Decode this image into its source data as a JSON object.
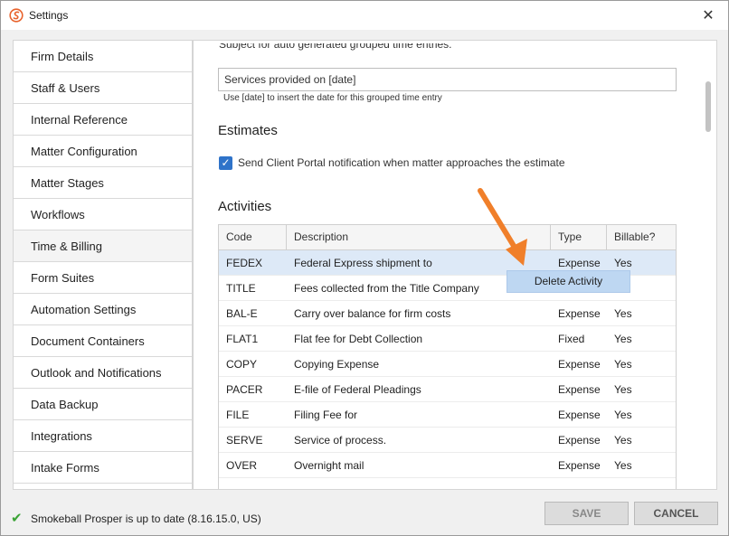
{
  "window": {
    "title": "Settings",
    "close_glyph": "✕",
    "logo_icon": "smokeball-logo"
  },
  "sidebar": {
    "items": [
      {
        "label": "Firm Details",
        "active": false
      },
      {
        "label": "Staff & Users",
        "active": false
      },
      {
        "label": "Internal Reference",
        "active": false
      },
      {
        "label": "Matter Configuration",
        "active": false
      },
      {
        "label": "Matter Stages",
        "active": false
      },
      {
        "label": "Workflows",
        "active": false
      },
      {
        "label": "Time & Billing",
        "active": true
      },
      {
        "label": "Form Suites",
        "active": false
      },
      {
        "label": "Automation Settings",
        "active": false
      },
      {
        "label": "Document Containers",
        "active": false
      },
      {
        "label": "Outlook and Notifications",
        "active": false
      },
      {
        "label": "Data Backup",
        "active": false
      },
      {
        "label": "Integrations",
        "active": false
      },
      {
        "label": "Intake Forms",
        "active": false
      }
    ]
  },
  "main": {
    "cut_label": "Subject for auto generated grouped time entries:",
    "date_input_value": "Services provided on [date]",
    "date_hint": "Use [date] to insert the date for this grouped time entry",
    "estimates_heading": "Estimates",
    "estimate_checkbox_label": "Send Client Portal notification when matter approaches the estimate",
    "estimate_checkbox_checked": true,
    "activities_heading": "Activities",
    "table": {
      "headers": {
        "code": "Code",
        "description": "Description",
        "type": "Type",
        "billable": "Billable?"
      },
      "rows": [
        {
          "code": "FEDEX",
          "description": "Federal Express shipment to",
          "type": "Expense",
          "billable": "Yes",
          "selected": true
        },
        {
          "code": "TITLE",
          "description": "Fees collected from the Title Company",
          "type": "",
          "billable": "",
          "selected": false
        },
        {
          "code": "BAL-E",
          "description": "Carry over balance for firm costs",
          "type": "Expense",
          "billable": "Yes",
          "selected": false
        },
        {
          "code": "FLAT1",
          "description": "Flat fee for Debt Collection",
          "type": "Fixed",
          "billable": "Yes",
          "selected": false
        },
        {
          "code": "COPY",
          "description": "Copying Expense",
          "type": "Expense",
          "billable": "Yes",
          "selected": false
        },
        {
          "code": "PACER",
          "description": "E-file of Federal Pleadings",
          "type": "Expense",
          "billable": "Yes",
          "selected": false
        },
        {
          "code": "FILE",
          "description": "Filing Fee for",
          "type": "Expense",
          "billable": "Yes",
          "selected": false
        },
        {
          "code": "SERVE",
          "description": "Service of process.",
          "type": "Expense",
          "billable": "Yes",
          "selected": false
        },
        {
          "code": "OVER",
          "description": "Overnight mail",
          "type": "Expense",
          "billable": "Yes",
          "selected": false
        }
      ]
    },
    "context_menu": {
      "item": "Delete Activity"
    }
  },
  "footer": {
    "status": "Smokeball Prosper is up to date (8.16.15.0, US)",
    "status_icon": "checkmark-icon",
    "save_label": "SAVE",
    "cancel_label": "CANCEL"
  },
  "colors": {
    "selected_row": "#dde9f7",
    "context_menu": "#bed7f2",
    "arrow": "#f07f2a",
    "checkbox": "#2f73c9",
    "status_check": "#3aa335"
  }
}
